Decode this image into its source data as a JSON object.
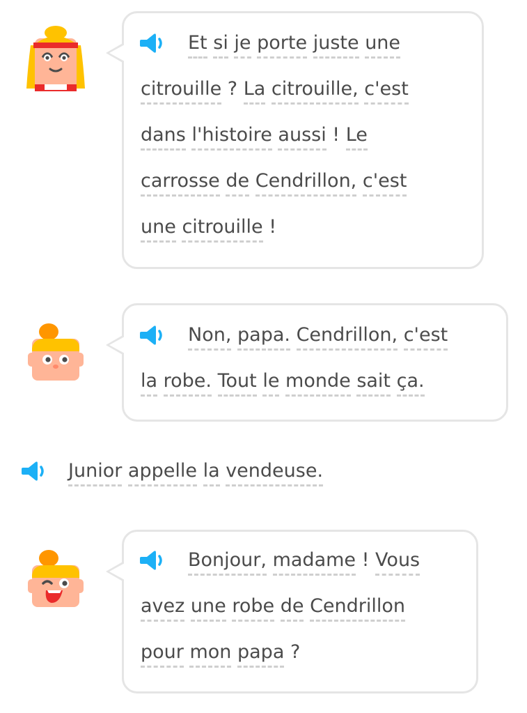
{
  "colors": {
    "speaker_blue": "#1cb0f6",
    "bubble_border": "#e5e5e5",
    "text": "#4b4b4b",
    "dash": "#cfcfcf"
  },
  "icons": {
    "speaker": "speaker-icon",
    "avatar_1": "avatar-lily-icon",
    "avatar_2": "avatar-junior-icon",
    "avatar_3": "avatar-junior-laughing-icon"
  },
  "messages": [
    {
      "speaker": "Lin",
      "lines": [
        [
          "Et",
          "si",
          "je",
          "porte",
          "juste",
          "une"
        ],
        [
          "citrouille",
          "?",
          "La",
          "citrouille,",
          "c'est"
        ],
        [
          "dans",
          "l'histoire",
          "aussi",
          "!",
          "Le"
        ],
        [
          "carrosse",
          "de",
          "Cendrillon,",
          "c'est"
        ],
        [
          "une",
          "citrouille",
          "!"
        ]
      ]
    },
    {
      "speaker": "Junior",
      "lines": [
        [
          "Non,",
          "papa.",
          "Cendrillon,",
          "c'est"
        ],
        [
          "la",
          "robe.",
          "Tout",
          "le",
          "monde",
          "sait",
          "ça."
        ]
      ]
    },
    {
      "narration": true,
      "lines": [
        [
          "Junior",
          "appelle",
          "la",
          "vendeuse."
        ]
      ]
    },
    {
      "speaker": "Junior",
      "lines": [
        [
          "Bonjour,",
          "madame",
          "!",
          "Vous"
        ],
        [
          "avez",
          "une",
          "robe",
          "de",
          "Cendrillon"
        ],
        [
          "pour",
          "mon",
          "papa",
          "?"
        ]
      ]
    }
  ]
}
